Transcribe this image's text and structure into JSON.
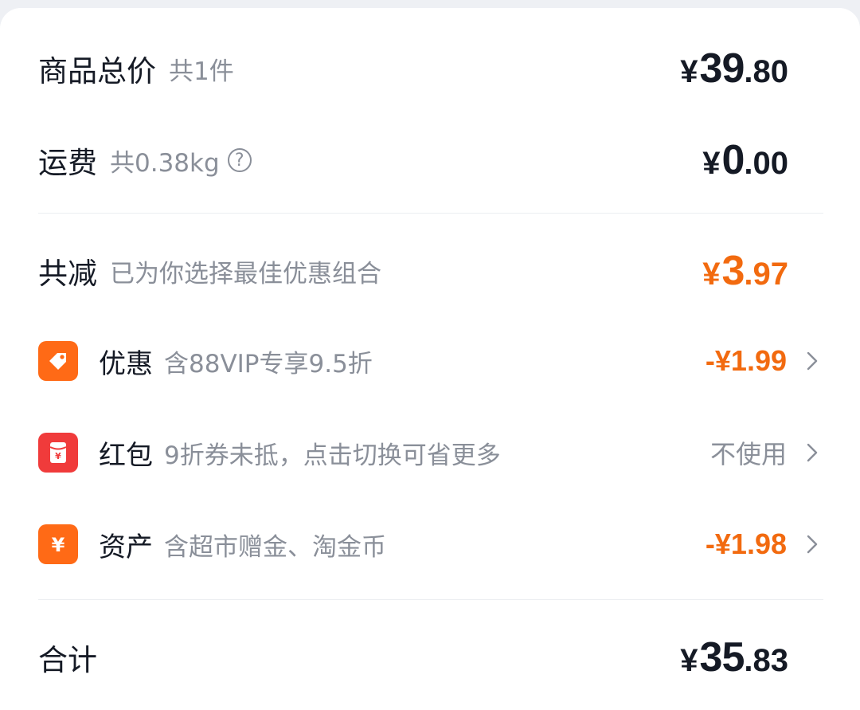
{
  "subtotal": {
    "label": "商品总价",
    "note": "共1件",
    "currency": "¥",
    "integer": "39",
    "decimal": ".80"
  },
  "shipping": {
    "label": "运费",
    "note": "共0.38kg",
    "help_glyph": "?",
    "currency": "¥",
    "integer": "0",
    "decimal": ".00"
  },
  "total_discount": {
    "label": "共减",
    "note": "已为你选择最佳优惠组合",
    "currency": "¥",
    "integer": "3",
    "decimal": ".97",
    "color": "#f26a0f"
  },
  "discounts": [
    {
      "icon": "tag-icon",
      "icon_color": "#ff6a16",
      "label": "优惠",
      "note": "含88VIP专享9.5折",
      "value": "-¥1.99"
    },
    {
      "icon": "red-packet-icon",
      "icon_color": "#f03b3b",
      "label": "红包",
      "note": "9折券未抵，点击切换可省更多",
      "value": "不使用"
    },
    {
      "icon": "yuan-coin-icon",
      "icon_color": "#ff6a16",
      "label": "资产",
      "note": "含超市赠金、淘金币",
      "value": "-¥1.98"
    }
  ],
  "grand_total": {
    "label": "合计",
    "currency": "¥",
    "integer": "35",
    "decimal": ".83"
  }
}
